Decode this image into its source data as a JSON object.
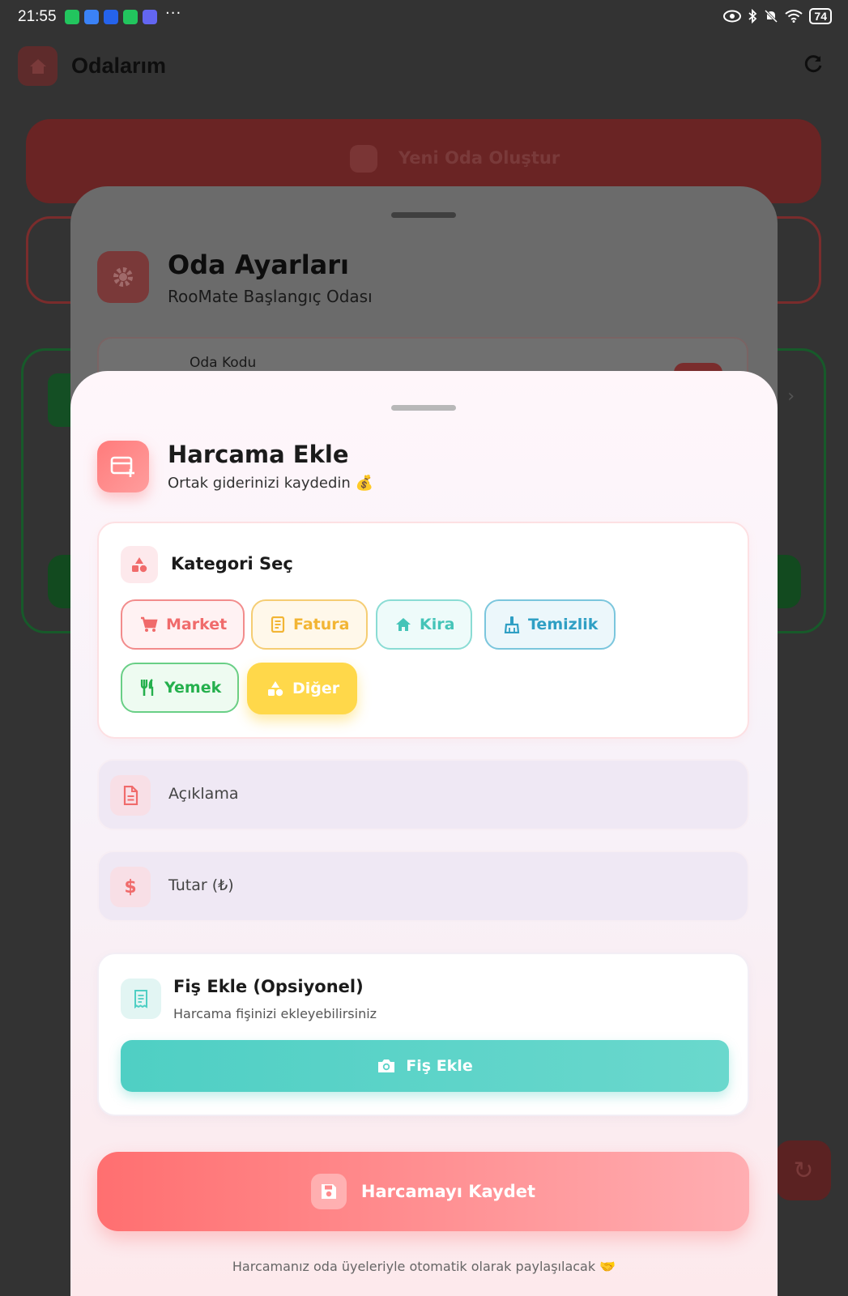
{
  "status_bar": {
    "time": "21:55",
    "more": "···",
    "battery": "74"
  },
  "app_bar": {
    "title": "Odalarım"
  },
  "background": {
    "create_room_label": "Yeni Oda Oluştur"
  },
  "room_settings_sheet": {
    "title": "Oda Ayarları",
    "subtitle": "RooMate Başlangıç Odası",
    "room_code_label": "Oda Kodu"
  },
  "expense_sheet": {
    "title": "Harcama Ekle",
    "subtitle": "Ortak giderinizi kaydedin 💰",
    "category_section": {
      "title": "Kategori Seç",
      "selected": "Diğer",
      "chips": [
        {
          "label": "Market",
          "icon": "cart-icon",
          "color": "#f06b6b"
        },
        {
          "label": "Fatura",
          "icon": "receipt-icon",
          "color": "#f7bb3a"
        },
        {
          "label": "Kira",
          "icon": "home-icon",
          "color": "#4fcfc4"
        },
        {
          "label": "Temizlik",
          "icon": "broom-icon",
          "color": "#3aa7c9"
        },
        {
          "label": "Yemek",
          "icon": "fork-knife-icon",
          "color": "#2fbe57"
        },
        {
          "label": "Diğer",
          "icon": "shapes-icon",
          "color": "#ffd84a"
        }
      ]
    },
    "description_field": {
      "placeholder": "Açıklama",
      "icon": "document-icon"
    },
    "amount_field": {
      "placeholder": "Tutar (₺)",
      "icon": "dollar-icon",
      "icon_glyph": "$"
    },
    "receipt": {
      "title": "Fiş Ekle (Opsiyonel)",
      "subtitle": "Harcama fişinizi ekleyebilirsiniz",
      "button_label": "Fiş Ekle"
    },
    "save_button_label": "Harcamayı Kaydet",
    "footer_note": "Harcamanız oda üyeleriyle otomatik olarak paylaşılacak 🤝"
  }
}
